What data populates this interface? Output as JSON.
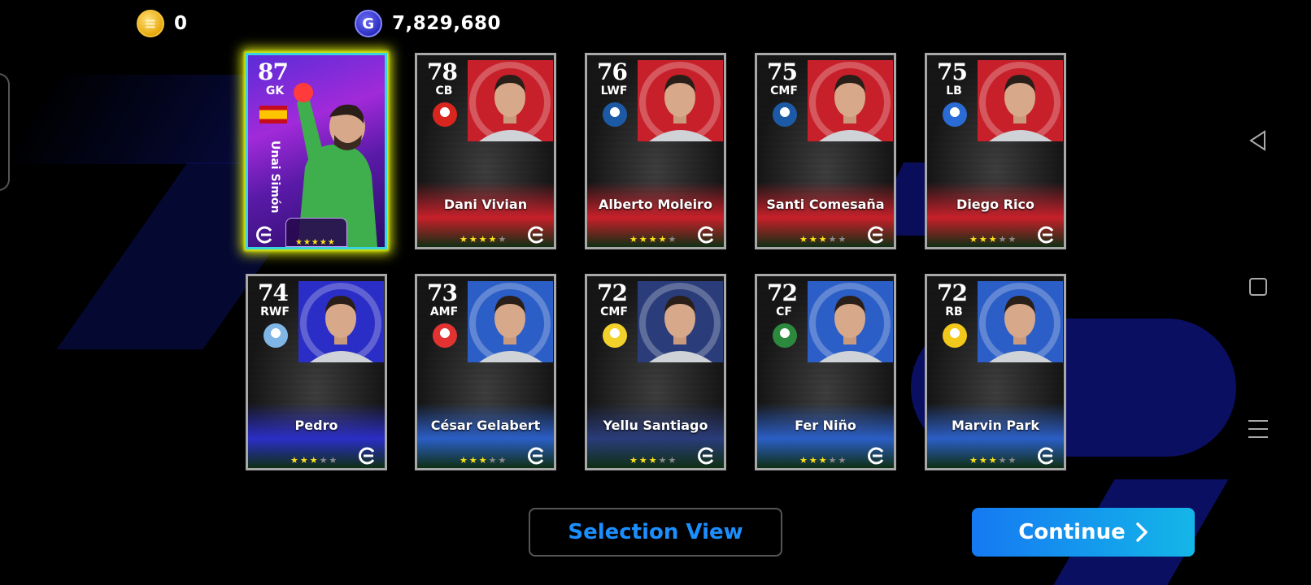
{
  "currencies": {
    "coins": {
      "icon": "efootball-coin-icon",
      "value": "0"
    },
    "gp": {
      "icon": "gp-icon",
      "value": "7,829,680"
    }
  },
  "cards": [
    {
      "rating": "87",
      "position": "GK",
      "name": "Unai Simón",
      "stars": 5,
      "featured": true,
      "nationality_flag": "spain-flag-icon"
    },
    {
      "rating": "78",
      "position": "CB",
      "name": "Dani Vivian",
      "stars": 4,
      "band": "#c7202a",
      "badge_color": "#d8261f"
    },
    {
      "rating": "76",
      "position": "LWF",
      "name": "Alberto Moleiro",
      "stars": 4,
      "band": "#c7202a",
      "badge_color": "#1c5aa6"
    },
    {
      "rating": "75",
      "position": "CMF",
      "name": "Santi Comesaña",
      "stars": 3,
      "band": "#c7202a",
      "badge_color": "#1c5aa6"
    },
    {
      "rating": "75",
      "position": "LB",
      "name": "Diego Rico",
      "stars": 3,
      "band": "#c7202a",
      "badge_color": "#2a6bd6"
    },
    {
      "rating": "74",
      "position": "RWF",
      "name": "Pedro",
      "stars": 3,
      "band": "#2b2ec6",
      "badge_color": "#7fb6e6"
    },
    {
      "rating": "73",
      "position": "AMF",
      "name": "César Gelabert",
      "stars": 3,
      "band": "#2b5ec6",
      "badge_color": "#e23232"
    },
    {
      "rating": "72",
      "position": "CMF",
      "name": "Yellu Santiago",
      "stars": 3,
      "band": "#2a3c7a",
      "badge_color": "#f2d22a"
    },
    {
      "rating": "72",
      "position": "CF",
      "name": "Fer Niño",
      "stars": 3,
      "band": "#2b5ec6",
      "badge_color": "#2b8a3e"
    },
    {
      "rating": "72",
      "position": "RB",
      "name": "Marvin Park",
      "stars": 3,
      "band": "#2b5ec6",
      "badge_color": "#f2c81a"
    }
  ],
  "buttons": {
    "selection_view": "Selection View",
    "continue": "Continue"
  },
  "colors": {
    "accent_blue": "#1c8fff",
    "continue_gradient_start": "#1579f2",
    "continue_gradient_end": "#14b6e8",
    "featured_glow": "#d9e80c",
    "star_on": "#ffe21a"
  }
}
